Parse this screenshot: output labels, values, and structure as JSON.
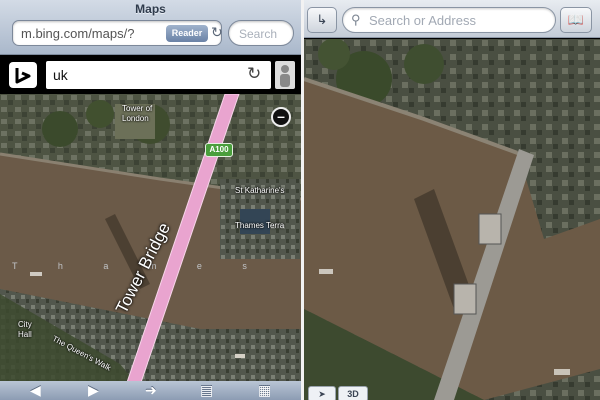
{
  "left_phone": {
    "browser": {
      "title": "Maps",
      "url": "m.bing.com/maps/?",
      "reader_label": "Reader",
      "search_placeholder": "Search"
    },
    "bing": {
      "query": "uk"
    },
    "map": {
      "labels": {
        "tower_of_london": "Tower of\nLondon",
        "road": "A100",
        "st_katharine": "St Katharine's",
        "thames_terrace": "Thames Terra",
        "thames": "T h a m e s",
        "tower_bridge": "Tower Bridge",
        "city_hall": "City\nHall",
        "queens_walk": "The Queen's Walk"
      }
    },
    "toolbar_icons": [
      "back-arrow",
      "forward-arrow",
      "share",
      "bookmarks",
      "tabs"
    ]
  },
  "right_phone": {
    "search_placeholder": "Search or Address",
    "threed_label": "3D"
  },
  "colors": {
    "safari_bar": "#aab8cb",
    "bridge_pink": "#e9a4cf",
    "river": "#6b5a48"
  }
}
